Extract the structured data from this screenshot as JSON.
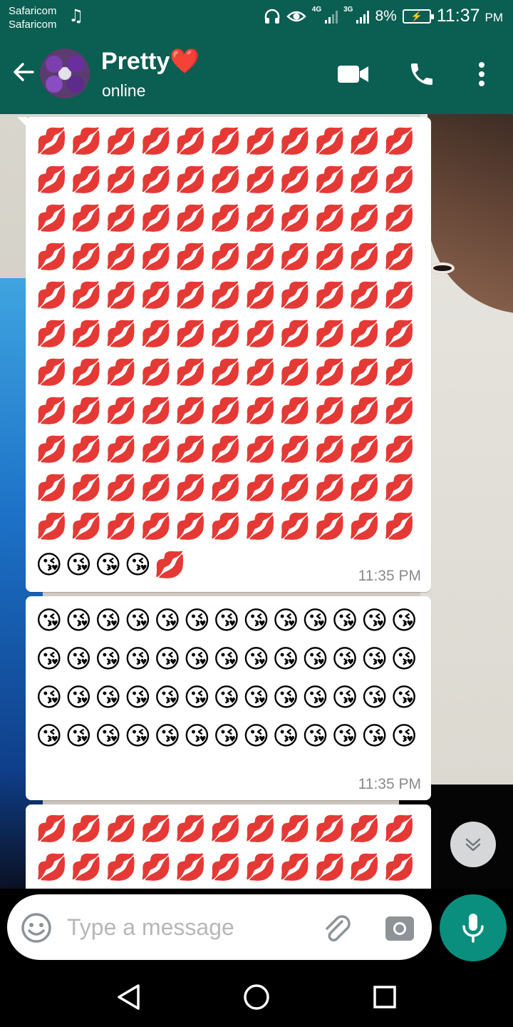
{
  "status_bar": {
    "carrier_line1": "Safaricom",
    "carrier_line2": "Safaricom",
    "network_1": "4G",
    "network_2": "3G",
    "battery": "8%",
    "time": "11:37",
    "ampm": "PM"
  },
  "header": {
    "contact_name": "Pretty❤️",
    "contact_status": "online"
  },
  "messages": [
    {
      "text": "💋💋💋💋💋💋💋💋💋💋💋💋💋💋💋💋💋💋💋💋💋💋💋💋💋💋💋💋💋💋💋💋💋💋💋💋💋💋💋💋💋💋💋💋💋💋💋💋💋💋💋💋💋💋💋💋💋💋💋💋💋💋💋💋💋💋💋💋💋💋💋💋💋💋💋💋💋💋💋💋💋💋💋💋💋💋💋💋💋💋💋💋💋💋💋💋💋💋💋💋💋💋💋💋💋💋💋💋💋💋💋💋💋💋💋💋💋💋💋💋💋😘😘😘😘💋",
      "time": "11:35 PM"
    },
    {
      "text": "😘😘😘😘😘😘😘😘😘😘😘😘😘😘😘😘😘😘😘😘😘😘😘😘😘😘😘😘😘😘😘😘😘😘😘😘😘😘😘😘😘😘😘😘😘😘😘😘😘😘😘😘",
      "time": "11:35 PM"
    },
    {
      "text": "💋💋💋💋💋💋💋💋💋💋💋💋💋💋💋💋💋💋💋💋💋💋",
      "time": ""
    }
  ],
  "input": {
    "placeholder": "Type a message"
  },
  "colors": {
    "header": "#0a5e52",
    "accent": "#0a8f7e",
    "bubble": "#ffffff"
  },
  "icons": {
    "back": "arrow-left-icon",
    "video": "video-camera-icon",
    "phone": "phone-icon",
    "menu": "more-vertical-icon",
    "emoji": "smiley-icon",
    "attach": "paperclip-icon",
    "camera": "camera-icon",
    "mic": "microphone-icon",
    "scroll": "chevron-double-down-icon"
  }
}
